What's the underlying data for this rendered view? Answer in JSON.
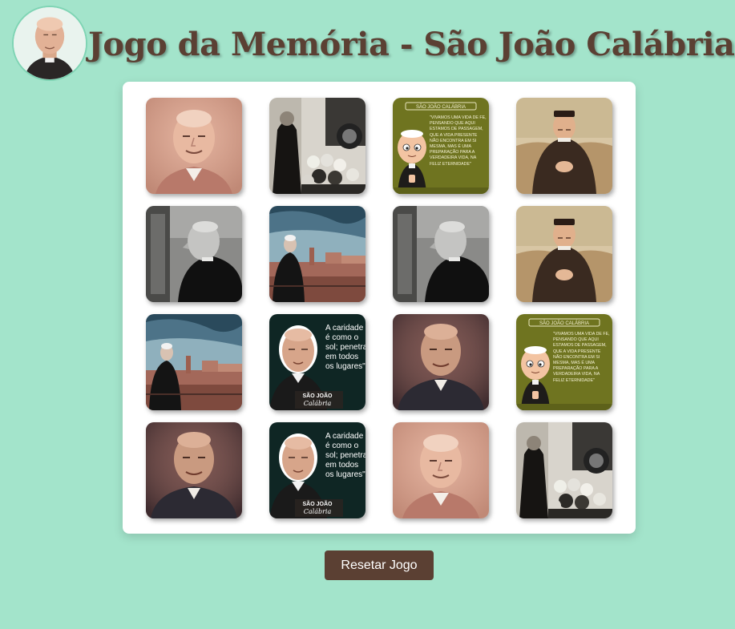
{
  "header": {
    "title": "Jogo da Memória - São João Calábria",
    "logo_icon": "portrait-icon"
  },
  "colors": {
    "background": "#a3e4cb",
    "title": "#5b4033",
    "button": "#5b4033",
    "board": "#ffffff"
  },
  "cards": [
    {
      "image": "portrait-pink"
    },
    {
      "image": "crowd-photo"
    },
    {
      "image": "cartoon-quote"
    },
    {
      "image": "painting-hands"
    },
    {
      "image": "bw-profile"
    },
    {
      "image": "city-view"
    },
    {
      "image": "bw-profile"
    },
    {
      "image": "painting-hands"
    },
    {
      "image": "city-view"
    },
    {
      "image": "charity-quote"
    },
    {
      "image": "portrait-dark"
    },
    {
      "image": "cartoon-quote"
    },
    {
      "image": "portrait-dark"
    },
    {
      "image": "charity-quote"
    },
    {
      "image": "portrait-pink"
    },
    {
      "image": "crowd-photo"
    }
  ],
  "card_text": {
    "cartoon_header": "SÃO JOÃO CALÁBRIA",
    "cartoon_quote": "\"VIVAMOS UMA VIDA DE FÉ, PENSANDO QUE AQUI ESTAMOS DE PASSAGEM, QUE A VIDA PRESENTE NÃO ENCONTRA EM SI MESMA, MAS É UMA PREPARAÇÃO PARA A VERDADEIRA VIDA, NA FELIZ ETERNIDADE\"",
    "charity_quote_lines": [
      "A caridade",
      "é como o",
      "sol; penetra",
      "em todos",
      "os lugares\""
    ],
    "charity_name_top": "SÃO JOÃO",
    "charity_name_bottom": "Calábria"
  },
  "controls": {
    "reset_label": "Resetar Jogo"
  }
}
